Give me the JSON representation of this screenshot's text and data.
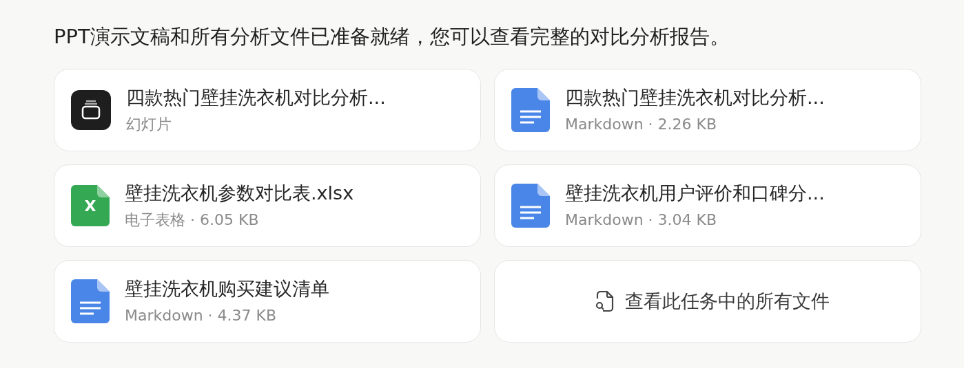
{
  "message": "PPT演示文稿和所有分析文件已准备就绪，您可以查看完整的对比分析报告。",
  "files": [
    {
      "kind": "slides",
      "name": "四款热门壁挂洗衣机对比分析...",
      "meta": "幻灯片"
    },
    {
      "kind": "doc",
      "name": "四款热门壁挂洗衣机对比分析...",
      "meta": "Markdown · 2.26 KB"
    },
    {
      "kind": "sheet",
      "name": "壁挂洗衣机参数对比表.xlsx",
      "meta": "电子表格 · 6.05 KB",
      "icon_letter": "X"
    },
    {
      "kind": "doc",
      "name": "壁挂洗衣机用户评价和口碑分...",
      "meta": "Markdown · 3.04 KB"
    },
    {
      "kind": "doc",
      "name": "壁挂洗衣机购买建议清单",
      "meta": "Markdown · 4.37 KB"
    }
  ],
  "view_all": {
    "label": "查看此任务中的所有文件"
  }
}
